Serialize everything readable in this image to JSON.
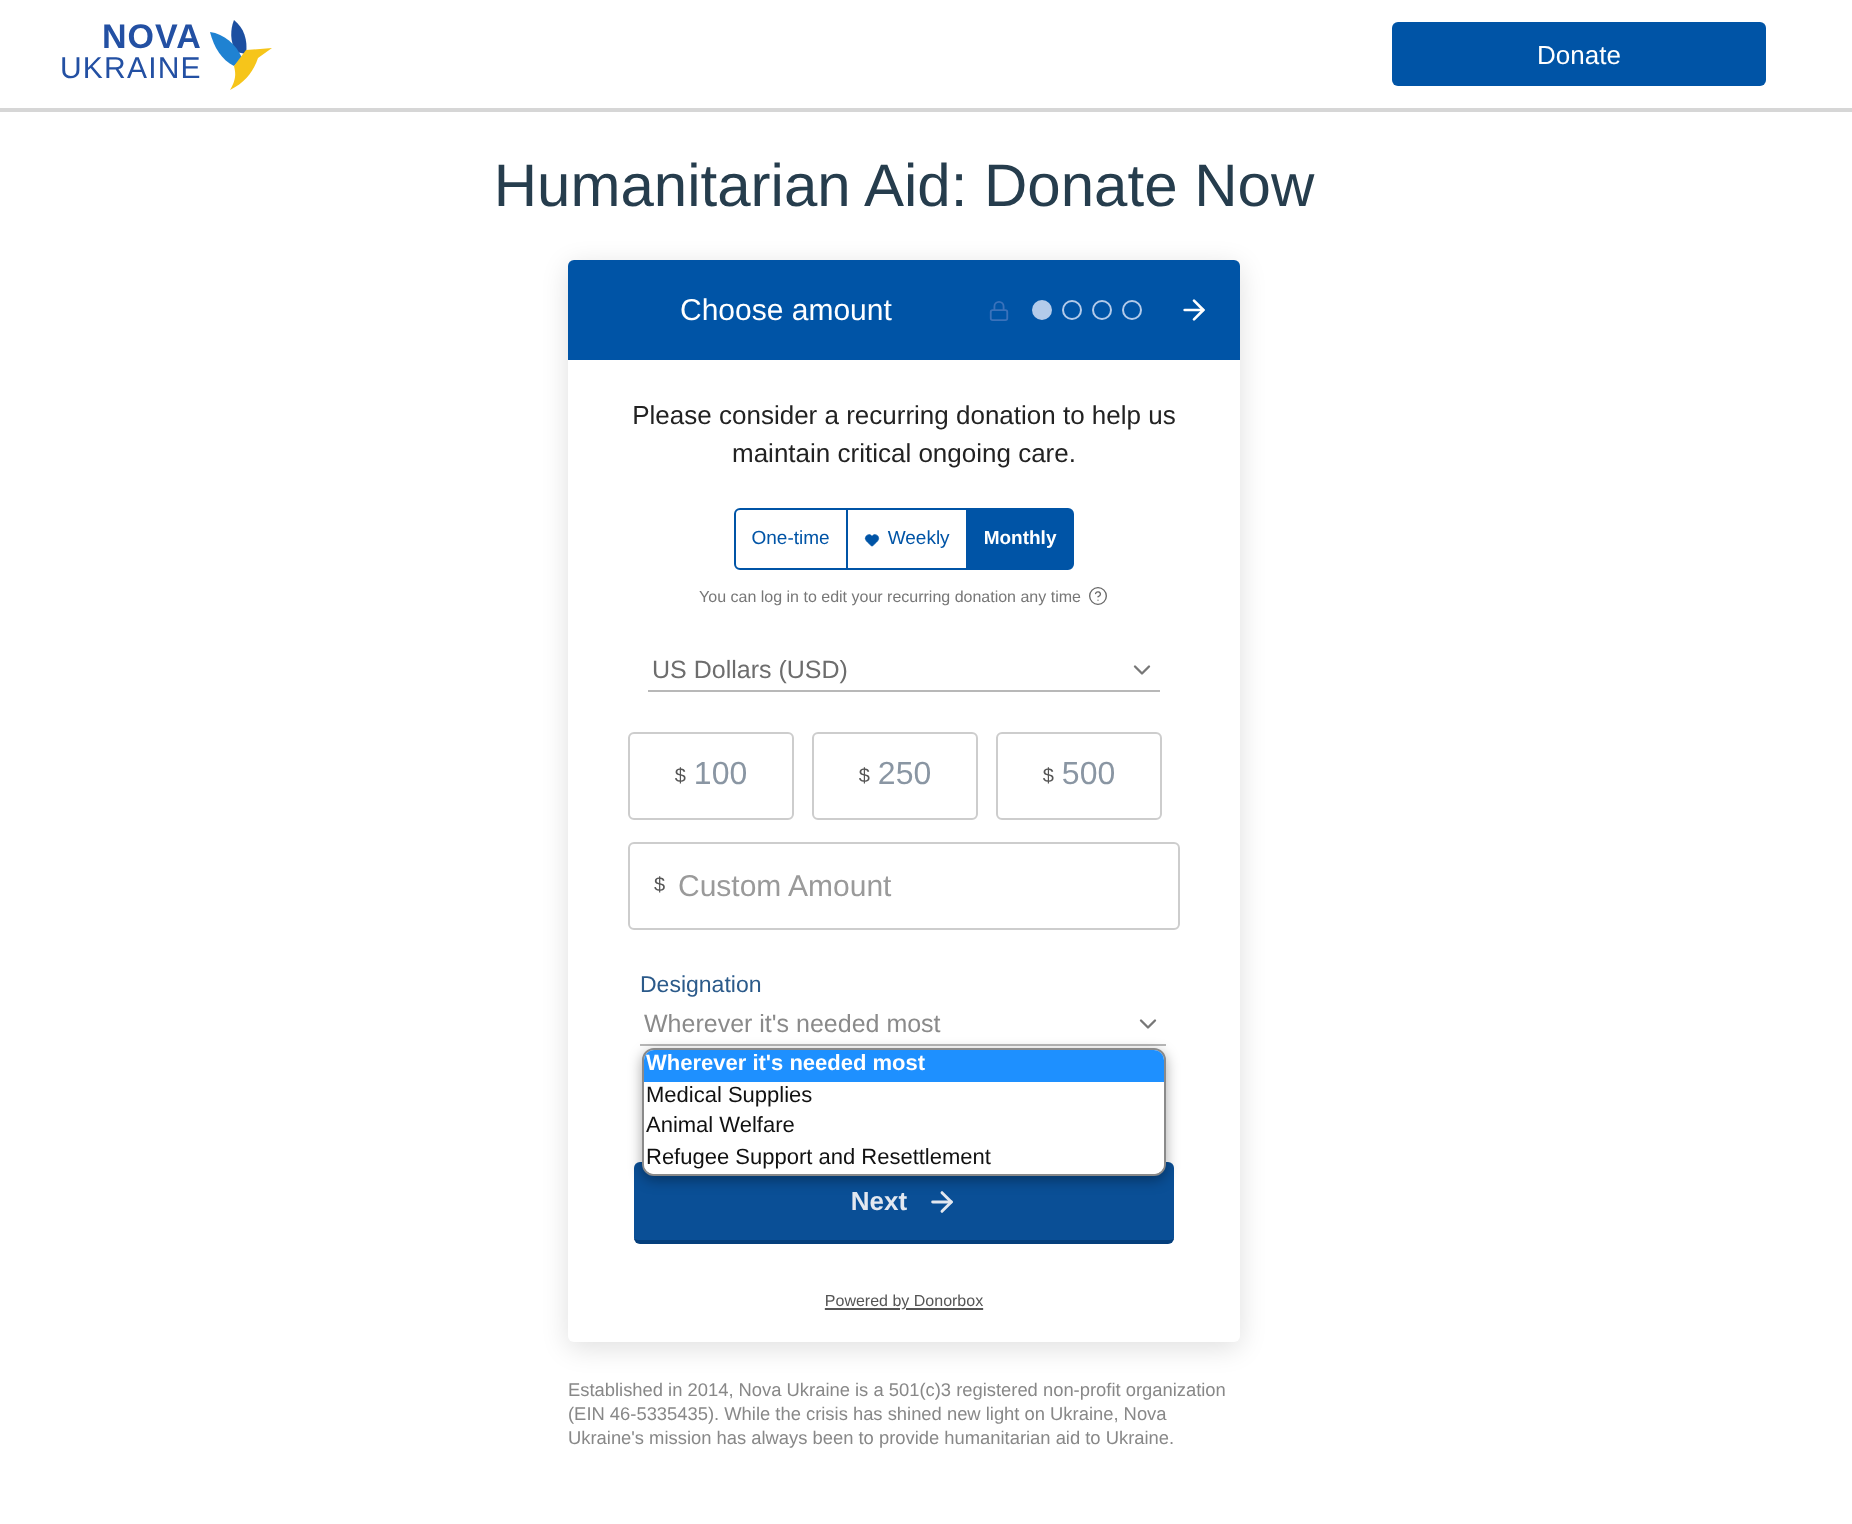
{
  "header": {
    "logo": {
      "line_1": "NOVA",
      "line_2": "UKRAINE"
    },
    "donate_button": "Donate"
  },
  "title": "Humanitarian Aid: Donate Now",
  "card": {
    "step_title": "Choose amount",
    "steps": [
      {
        "selected": true
      },
      {
        "selected": false
      },
      {
        "selected": false
      },
      {
        "selected": false
      }
    ],
    "message": "Please consider a recurring donation to help us maintain critical ongoing care.",
    "frequencies": [
      {
        "label": "One-time",
        "selected": false,
        "featured": false
      },
      {
        "label": "Weekly",
        "selected": false,
        "featured": true
      },
      {
        "label": "Monthly",
        "selected": true,
        "featured": false
      }
    ],
    "recurring_hint": "You can log in to edit your recurring donation any time",
    "currency": {
      "value": "US Dollars (USD)"
    },
    "amounts": [
      {
        "currency_symbol": "$",
        "value": "100"
      },
      {
        "currency_symbol": "$",
        "value": "250"
      },
      {
        "currency_symbol": "$",
        "value": "500"
      }
    ],
    "custom_amount": {
      "currency_symbol": "$",
      "placeholder": "Custom Amount"
    },
    "designation": {
      "label": "Designation",
      "value": "Wherever it's needed most",
      "expanded": true,
      "options": [
        {
          "label": "Wherever it's needed most",
          "selected": true
        },
        {
          "label": "Medical Supplies",
          "selected": false
        },
        {
          "label": "Animal Welfare",
          "selected": false
        },
        {
          "label": "Refugee Support and Resettlement",
          "selected": false
        }
      ]
    },
    "next_button": "Next",
    "powered_by": "Powered by Donorbox"
  },
  "footer": "Established in 2014, Nova Ukraine is a 501(c)3 registered non-profit organization (EIN 46-5335435). While the crisis has shined new light on Ukraine, Nova Ukraine's mission has always been to provide humanitarian aid to Ukraine."
}
